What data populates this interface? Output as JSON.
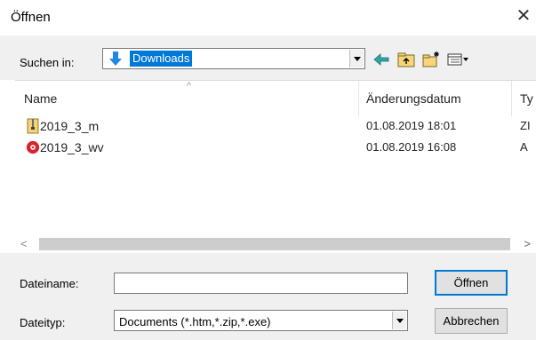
{
  "window": {
    "title": "Öffnen",
    "close_glyph": "✕"
  },
  "toolbar": {
    "look_in_label": "Suchen in:",
    "location": "Downloads",
    "icons": [
      "back-arrow-icon",
      "up-folder-icon",
      "new-folder-icon",
      "view-menu-icon"
    ]
  },
  "file_list": {
    "columns": [
      "Name",
      "Änderungsdatum",
      "Ty"
    ],
    "rows": [
      {
        "name": "2019_3_m",
        "date": "01.08.2019 18:01",
        "type": "ZI",
        "icon": "zip-file-icon"
      },
      {
        "name": "2019_3_wv",
        "date": "01.08.2019 16:08",
        "type": "A",
        "icon": "app-file-icon"
      }
    ]
  },
  "scrollbar": {
    "left": "<",
    "right": ">"
  },
  "form": {
    "filename_label": "Dateiname:",
    "filename_value": "",
    "filetype_label": "Dateityp:",
    "filetype_value": "Documents (*.htm,*.zip,*.exe)",
    "open_button": "Öffnen",
    "cancel_button": "Abbrechen"
  },
  "colors": {
    "accent": "#0078d7",
    "panel": "#f0f0f0"
  }
}
